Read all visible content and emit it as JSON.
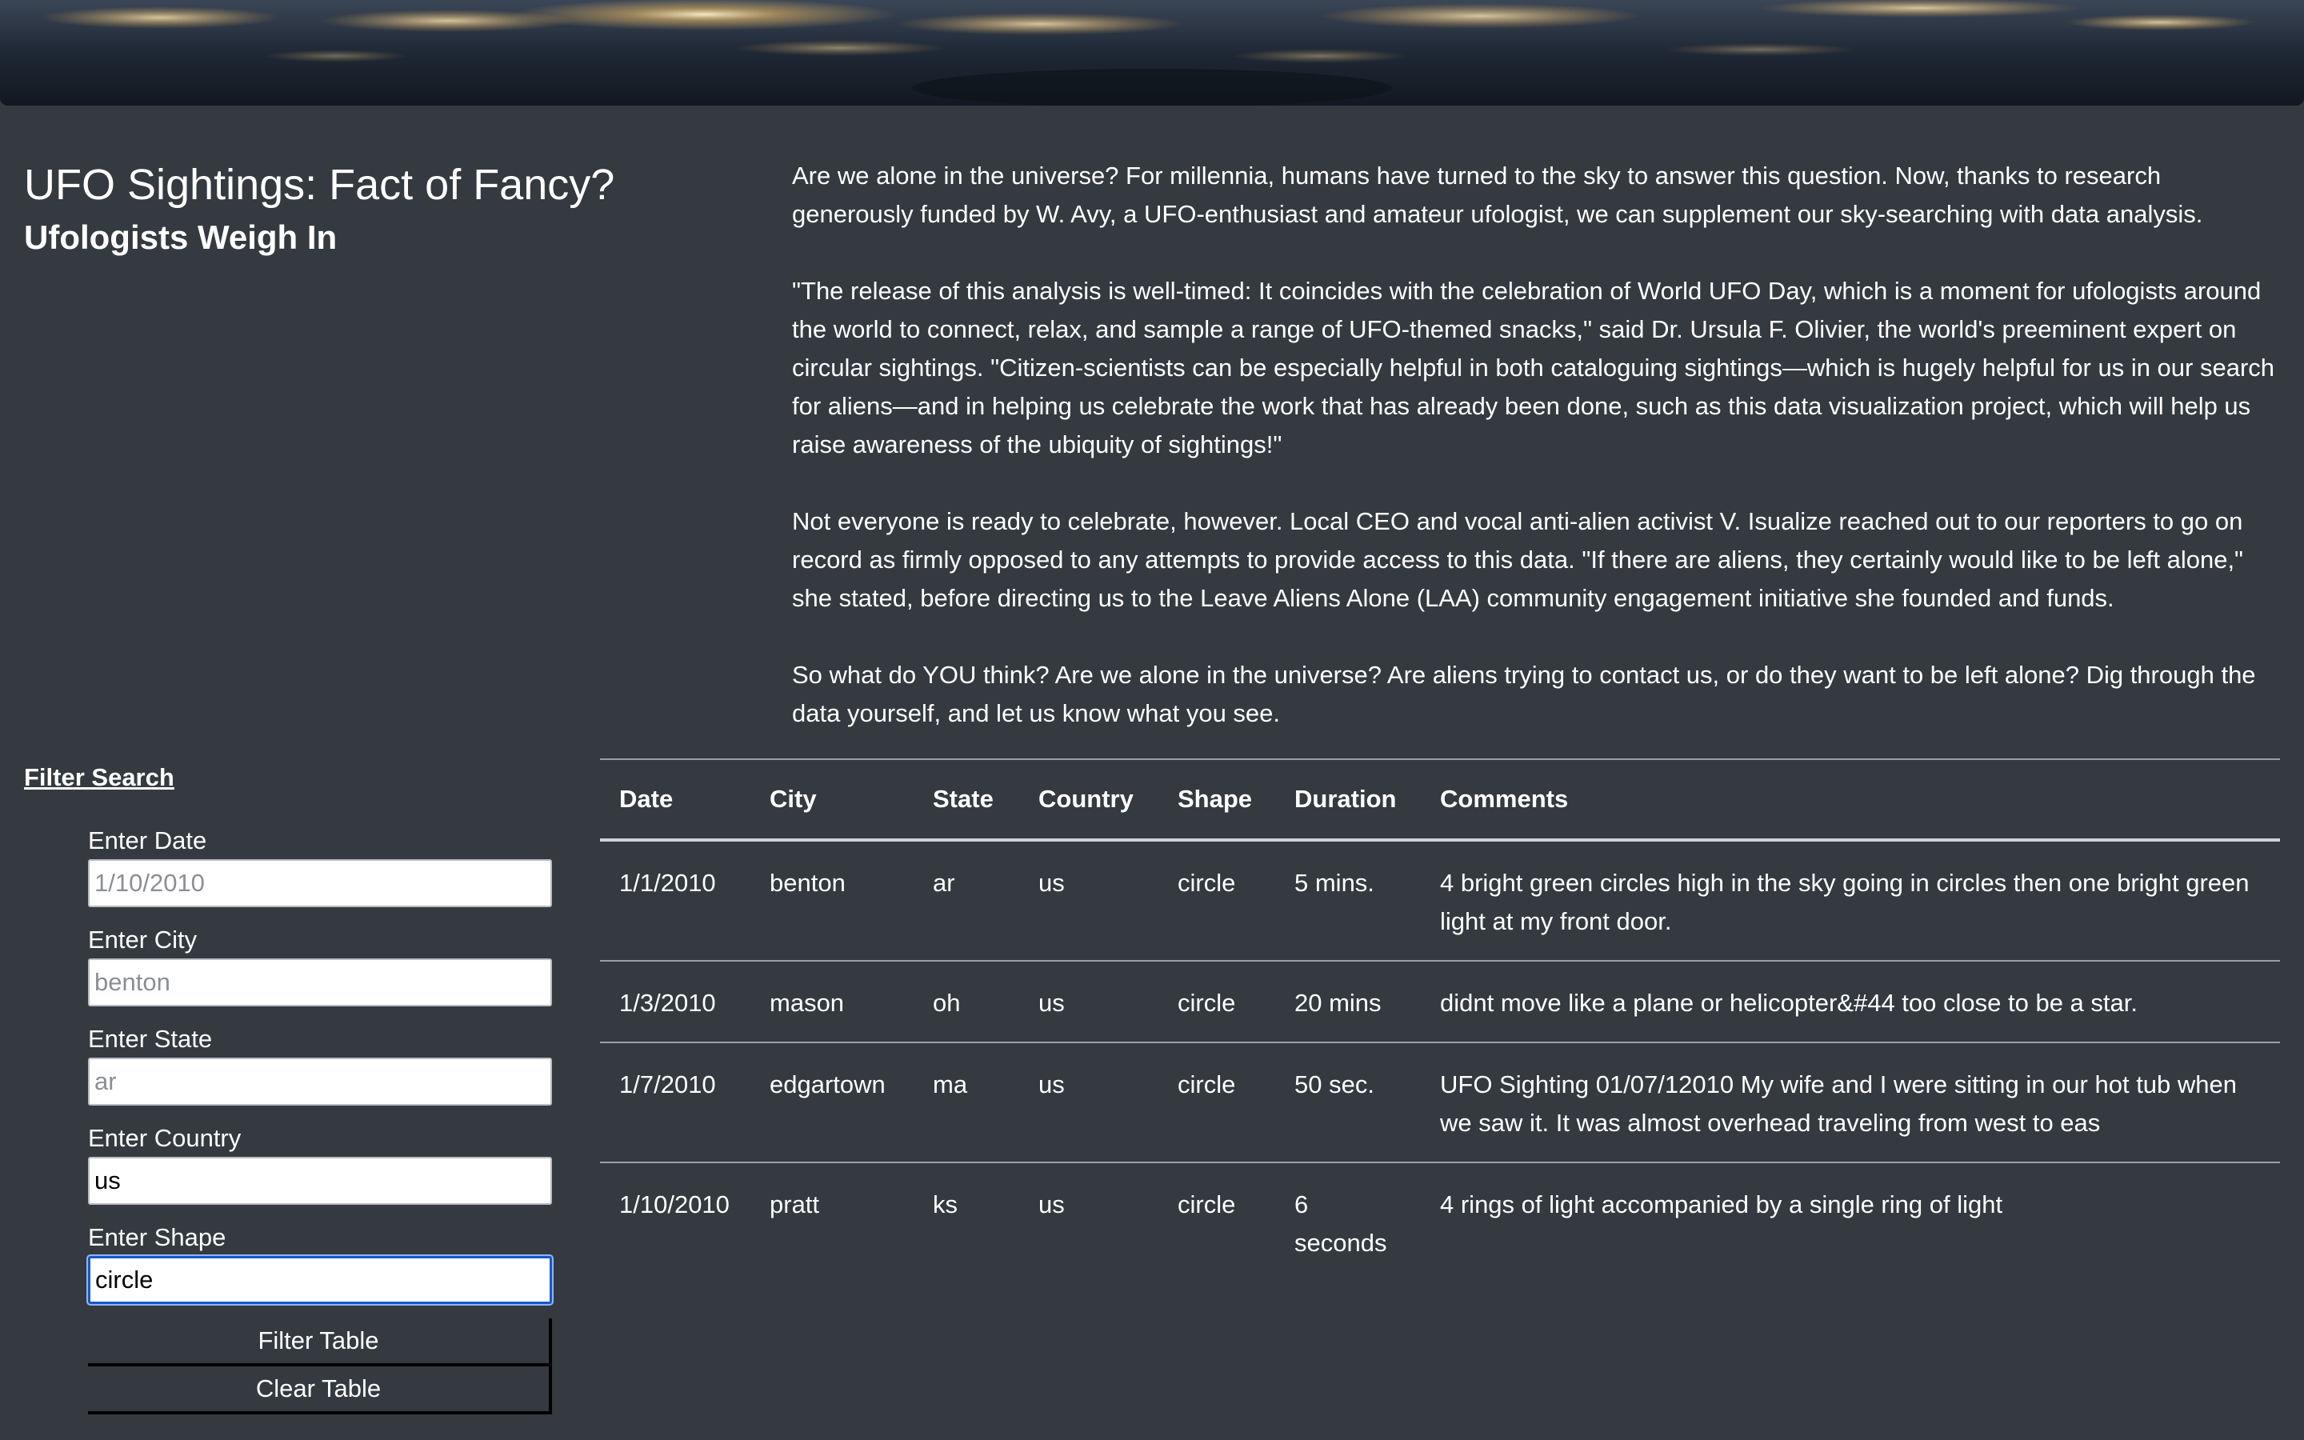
{
  "header": {
    "title": "UFO Sightings: Fact of Fancy?",
    "subtitle": "Ufologists Weigh In"
  },
  "article": {
    "paragraphs": [
      "Are we alone in the universe? For millennia, humans have turned to the sky to answer this question. Now, thanks to research generously funded by W. Avy, a UFO-enthusiast and amateur ufologist, we can supplement our sky-searching with data analysis.",
      "\"The release of this analysis is well-timed: It coincides with the celebration of World UFO Day, which is a moment for ufologists around the world to connect, relax, and sample a range of UFO-themed snacks,\" said Dr. Ursula F. Olivier, the world's preeminent expert on circular sightings. \"Citizen-scientists can be especially helpful in both cataloguing sightings—which is hugely helpful for us in our search for aliens—and in helping us celebrate the work that has already been done, such as this data visualization project, which will help us raise awareness of the ubiquity of sightings!\"",
      "Not everyone is ready to celebrate, however. Local CEO and vocal anti-alien activist V. Isualize reached out to our reporters to go on record as firmly opposed to any attempts to provide access to this data. \"If there are aliens, they certainly would like to be left alone,\" she stated, before directing us to the Leave Aliens Alone (LAA) community engagement initiative she founded and funds.",
      "So what do YOU think? Are we alone in the universe? Are aliens trying to contact us, or do they want to be left alone? Dig through the data yourself, and let us know what you see."
    ]
  },
  "filters": {
    "heading": "Filter Search",
    "date": {
      "label": "Enter Date",
      "value": "",
      "placeholder": "1/10/2010"
    },
    "city": {
      "label": "Enter City",
      "value": "",
      "placeholder": "benton"
    },
    "state": {
      "label": "Enter State",
      "value": "",
      "placeholder": "ar"
    },
    "country": {
      "label": "Enter Country",
      "value": "us",
      "placeholder": ""
    },
    "shape": {
      "label": "Enter Shape",
      "value": "circle",
      "placeholder": ""
    },
    "filter_button": "Filter Table",
    "clear_button": "Clear Table"
  },
  "table": {
    "headers": [
      "Date",
      "City",
      "State",
      "Country",
      "Shape",
      "Duration",
      "Comments"
    ],
    "rows": [
      [
        "1/1/2010",
        "benton",
        "ar",
        "us",
        "circle",
        "5 mins.",
        "4 bright green circles high in the sky going in circles then one bright green light at my front door."
      ],
      [
        "1/3/2010",
        "mason",
        "oh",
        "us",
        "circle",
        "20 mins",
        "didnt move like a plane or helicopter&#44 too close to be a star."
      ],
      [
        "1/7/2010",
        "edgartown",
        "ma",
        "us",
        "circle",
        "50 sec.",
        "UFO Sighting 01/07/12010 My wife and I were sitting in our hot tub when we saw it. It was almost overhead traveling from west to eas"
      ],
      [
        "1/10/2010",
        "pratt",
        "ks",
        "us",
        "circle",
        "6 seconds",
        "4 rings of light accompanied by a single ring of light"
      ]
    ]
  },
  "colors": {
    "page_background": "#343a40",
    "text": "#ffffff",
    "focus_border": "#1a57c8"
  }
}
